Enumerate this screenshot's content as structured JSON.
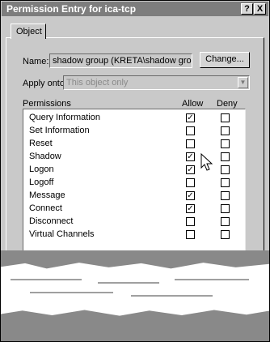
{
  "window": {
    "title": "Permission Entry for ica-tcp",
    "help_button": "?",
    "close_button": "X"
  },
  "tabs": [
    {
      "label": "Object"
    }
  ],
  "form": {
    "name_label": "Name:",
    "name_value": "shadow group (KRETA\\shadow group)",
    "change_button": "Change...",
    "apply_onto_label": "Apply onto:",
    "apply_onto_value": "This object only"
  },
  "permissions": {
    "header": "Permissions",
    "allow_header": "Allow",
    "deny_header": "Deny",
    "rows": [
      {
        "name": "Query Information",
        "allow": true,
        "deny": false
      },
      {
        "name": "Set Information",
        "allow": false,
        "deny": false
      },
      {
        "name": "Reset",
        "allow": false,
        "deny": false
      },
      {
        "name": "Shadow",
        "allow": true,
        "deny": false
      },
      {
        "name": "Logon",
        "allow": true,
        "deny": false
      },
      {
        "name": "Logoff",
        "allow": false,
        "deny": false
      },
      {
        "name": "Message",
        "allow": true,
        "deny": false
      },
      {
        "name": "Connect",
        "allow": true,
        "deny": false
      },
      {
        "name": "Disconnect",
        "allow": false,
        "deny": false
      },
      {
        "name": "Virtual Channels",
        "allow": false,
        "deny": false
      }
    ]
  },
  "icons": {
    "check": "check-mark-icon",
    "cursor": "mouse-cursor-icon"
  }
}
